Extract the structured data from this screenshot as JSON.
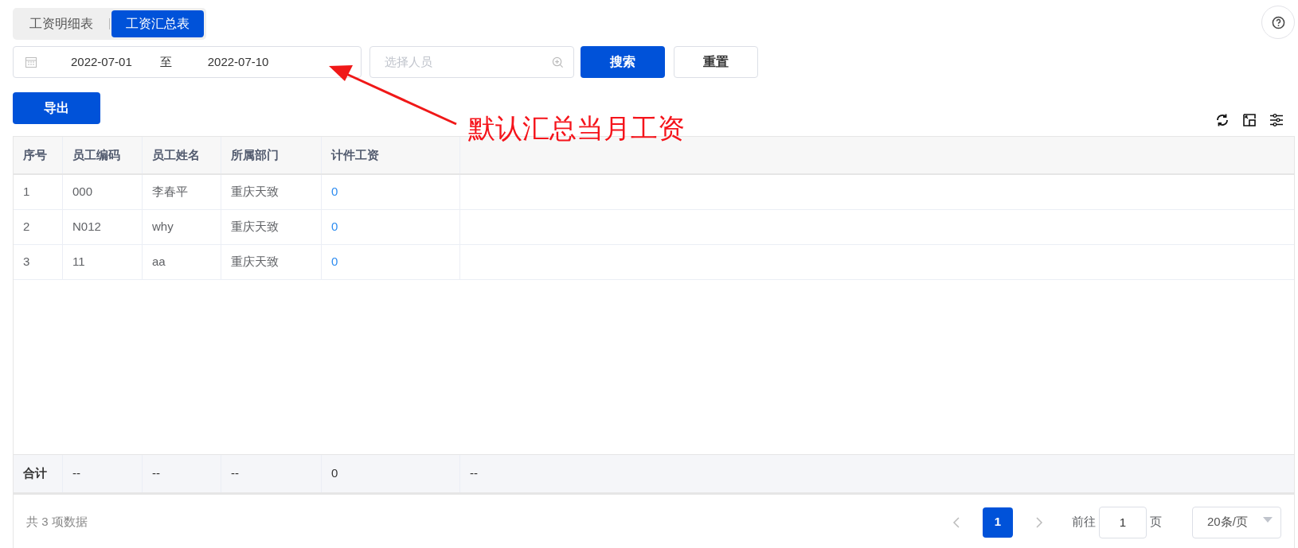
{
  "tabs": [
    {
      "label": "工资明细表",
      "selected": false
    },
    {
      "label": "工资汇总表",
      "selected": true
    }
  ],
  "filters": {
    "date_start": "2022-07-01",
    "date_separator": "至",
    "date_end": "2022-07-10",
    "person_placeholder": "选择人员",
    "search_button": "搜索",
    "reset_button": "重置"
  },
  "export_button": "导出",
  "table": {
    "columns": [
      "序号",
      "员工编码",
      "员工姓名",
      "所属部门",
      "计件工资"
    ],
    "rows": [
      [
        "1",
        "000",
        "李春平",
        "重庆天致",
        "0"
      ],
      [
        "2",
        "N012",
        "why",
        "重庆天致",
        "0"
      ],
      [
        "3",
        "11",
        "aa",
        "重庆天致",
        "0"
      ]
    ],
    "summary": [
      "合计",
      "--",
      "--",
      "--",
      "0",
      "--"
    ]
  },
  "pagination": {
    "total": "共 3 项数据",
    "pages": [
      {
        "label": "1",
        "selected": true
      }
    ],
    "goto_label": "前往",
    "goto_value": "1",
    "page_unit": "页",
    "page_size": "20条/页"
  },
  "annotation": {
    "text": "默认汇总当月工资"
  }
}
